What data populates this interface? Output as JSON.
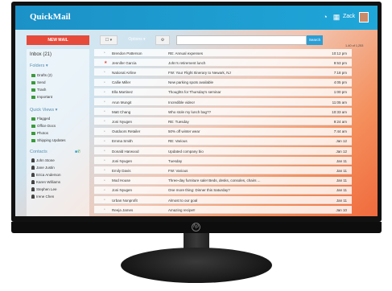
{
  "app": {
    "name": "QuickMail",
    "user": "Zack"
  },
  "header": {
    "icons": [
      "clock-icon",
      "grid-icon"
    ]
  },
  "toolbar": {
    "new_mail": "NEW MAIL",
    "select_label": "☐ ▾",
    "options_label": "Options ▾",
    "settings_icon": "⚙",
    "search_placeholder": "",
    "search_button": "Search",
    "count": "1-40 of 1,253"
  },
  "sidebar": {
    "inbox": "Inbox (21)",
    "folders_title": "Folders ▾",
    "folders": [
      "Drafts (2)",
      "Send",
      "Trash",
      "Important"
    ],
    "quick_views_title": "Quick Views ▾",
    "quick_views": [
      "Flagged",
      "Office Docs",
      "Photos",
      "Shipping Updates"
    ],
    "contacts_title": "Contacts",
    "contacts": [
      "John Stone",
      "Jane Justin",
      "Erica Anderson",
      "Karen Williams",
      "Stephen Lee",
      "Irene Chen"
    ]
  },
  "messages": [
    {
      "from": "Brendon Patterson",
      "subject": "RE: Annual expenses",
      "time": "10:12 pm",
      "starred": false
    },
    {
      "from": "Jennifer Garcia",
      "subject": "John's retirement lunch",
      "time": "9:53 pm",
      "starred": true
    },
    {
      "from": "National Airline",
      "subject": "FW: Your Flight Itinerary to Newark, NJ",
      "time": "7:18 pm",
      "starred": false
    },
    {
      "from": "Callie Miller",
      "subject": "New parking spots available",
      "time": "4:05 pm",
      "starred": false
    },
    {
      "from": "Ella Martinez",
      "subject": "Thoughts for Thursday's seminar",
      "time": "1:00 pm",
      "starred": false
    },
    {
      "from": "Arun Mungit",
      "subject": "Incredible video!",
      "time": "11:05 am",
      "starred": false
    },
    {
      "from": "Matt Chang",
      "subject": "Who stole my lunch bag??",
      "time": "10:33 am",
      "starred": false
    },
    {
      "from": "Joni Nyugen",
      "subject": "RE: Tuesday",
      "time": "9:24 am",
      "starred": false
    },
    {
      "from": "Outdoors Retailer",
      "subject": "50% off winter wear",
      "time": "7:44 am",
      "starred": false
    },
    {
      "from": "Emma Smith",
      "subject": "RE: Various",
      "time": "Jan 12",
      "starred": false
    },
    {
      "from": "Donald Harwood",
      "subject": "Updated company bio",
      "time": "Jan 12",
      "starred": false
    },
    {
      "from": "Joni Nyugen",
      "subject": "Tuesday",
      "time": "Jan 11",
      "starred": false
    },
    {
      "from": "Emily Davis",
      "subject": "FW: Various",
      "time": "Jan 11",
      "starred": false
    },
    {
      "from": "Mod House",
      "subject": "Three-day furniture sale! Beds, desks, consoles, chairs ...",
      "time": "Jan 11",
      "starred": false
    },
    {
      "from": "Joni Nyugen",
      "subject": "One more thing: Dinner this Saturday?",
      "time": "Jan 11",
      "starred": false
    },
    {
      "from": "Urban Nonprofit",
      "subject": "Almost to our goal",
      "time": "Jan 11",
      "starred": false
    },
    {
      "from": "Reeja James",
      "subject": "Amazing recipe!!",
      "time": "Jan 10",
      "starred": false
    }
  ],
  "colors": {
    "header": "#1b91c7",
    "accent": "#e64a3b",
    "search_button": "#2a9fd6",
    "folder": "#3c9a3c"
  }
}
